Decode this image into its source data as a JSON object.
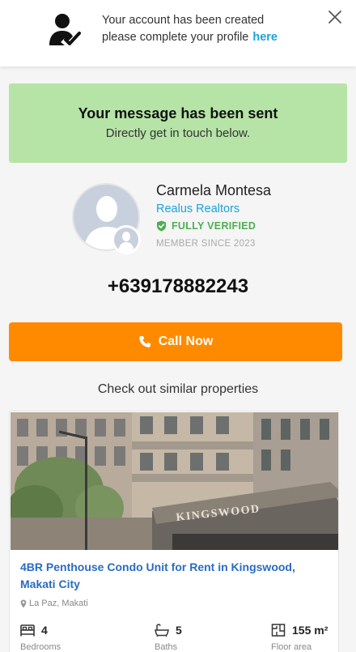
{
  "notice": {
    "line1": "Your account has been created",
    "line2": "please complete your profile",
    "link": "here",
    "icon": "user-check-icon",
    "close_icon": "close-icon"
  },
  "sent_banner": {
    "title": "Your message has been sent",
    "subtitle": "Directly get in touch below.",
    "color": "#b6e4a7"
  },
  "agent": {
    "name": "Carmela Montesa",
    "company": "Realus Realtors",
    "verified": "FULLY VERIFIED",
    "member_since": "MEMBER SINCE 2023",
    "phone": "+639178882243"
  },
  "call_button": {
    "label": "Call Now",
    "icon": "phone-icon",
    "color": "#ff8a00"
  },
  "similar": {
    "heading": "Check out similar properties",
    "properties": [
      {
        "title": "4BR Penthouse Condo Unit for Rent in Kingswood, Makati City",
        "location": "La Paz, Makati",
        "photo_sign": "KINGSWOOD",
        "bedrooms": "4",
        "bedrooms_label": "Bedrooms",
        "baths": "5",
        "baths_label": "Baths",
        "floor_area": "155 m²",
        "floor_area_label": "Floor area"
      }
    ]
  }
}
